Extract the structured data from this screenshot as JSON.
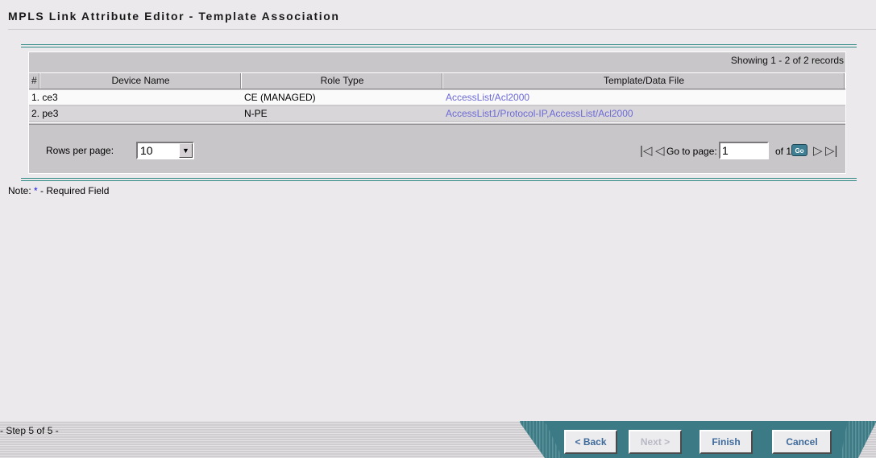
{
  "page": {
    "title": "MPLS Link Attribute Editor - Template Association"
  },
  "grid": {
    "records_text": "Showing 1 - 2 of 2 records",
    "columns": [
      "#",
      "Device Name",
      "Role Type",
      "Template/Data File"
    ],
    "rows": [
      {
        "num": "1.",
        "device": "ce3",
        "role": "CE (MANAGED)",
        "template": "AccessList/Acl2000"
      },
      {
        "num": "2.",
        "device": "pe3",
        "role": "N-PE",
        "template": "AccessList1/Protocol-IP,AccessList/Acl2000"
      }
    ]
  },
  "pager": {
    "rows_per_page_label": "Rows per page:",
    "rows_per_page_value": "10",
    "goto_label": "Go to page:",
    "page_value": "1",
    "of_label": "of 1",
    "go_label": "Go"
  },
  "note": {
    "prefix": "Note:",
    "star": "*",
    "text": "- Required Field"
  },
  "footer": {
    "step": "- Step 5 of 5 -",
    "back": "< Back",
    "next": "Next >",
    "finish": "Finish",
    "cancel": "Cancel"
  },
  "colors": {
    "accent_teal": "#2f8a85",
    "link": "#6b6ad6",
    "button_bar": "#3c7b86"
  },
  "icons": {
    "first": "first-page-icon",
    "prev": "prev-page-icon",
    "next": "next-page-icon",
    "last": "last-page-icon",
    "dropdown": "chevron-down-icon"
  }
}
